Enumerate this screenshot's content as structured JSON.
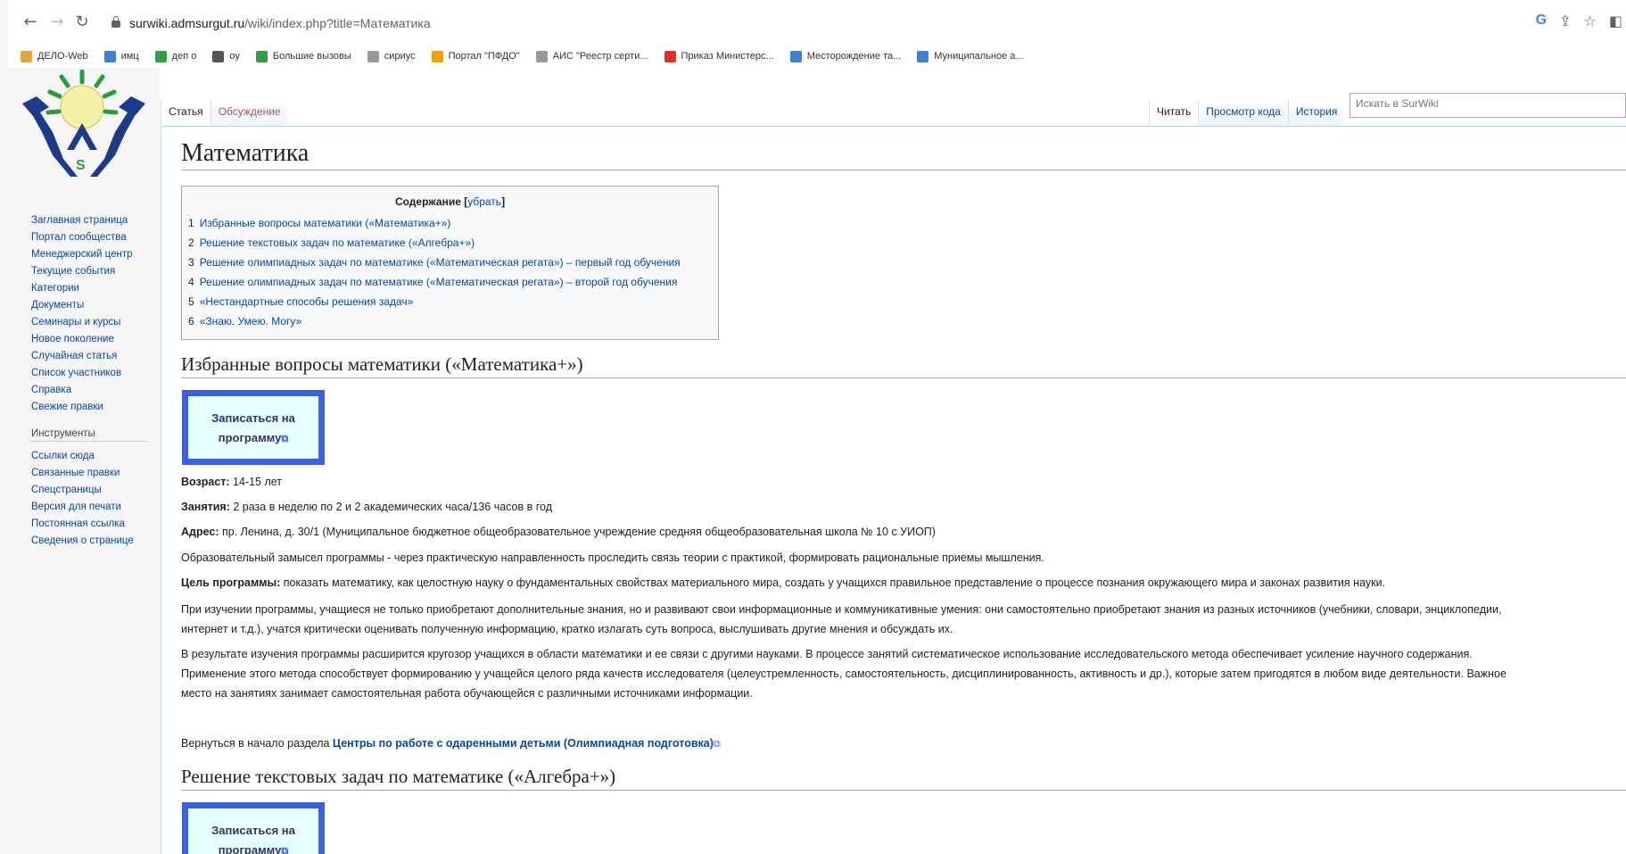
{
  "browser": {
    "url_domain": "surwiki.admsurgut.ru",
    "url_path": "/wiki/index.php?title=Математика",
    "bookmarks": [
      {
        "label": "ДЕЛО-Web",
        "color": "#e8a33d"
      },
      {
        "label": "имц",
        "color": "#3b82d6"
      },
      {
        "label": "деп о",
        "color": "#2f9e44"
      },
      {
        "label": "оу",
        "color": "#555555"
      },
      {
        "label": "Большие вызовы",
        "color": "#2f9e44"
      },
      {
        "label": "сириус",
        "color": "#999999"
      },
      {
        "label": "Портал \"ПФДО\"",
        "color": "#f59f00"
      },
      {
        "label": "АИС \"Реестр серти...",
        "color": "#999999"
      },
      {
        "label": "Приказ Министерс...",
        "color": "#e03131"
      },
      {
        "label": "Месторождение та...",
        "color": "#3b82d6"
      },
      {
        "label": "Муниципальное а...",
        "color": "#3b82d6"
      }
    ]
  },
  "sidebar": {
    "navigation": [
      "Заглавная страница",
      "Портал сообщества",
      "Менеджерский центр",
      "Текущие события",
      "Категории",
      "Документы",
      "Семинары и курсы",
      "Новое поколение",
      "Случайная статья",
      "Список участников",
      "Справка",
      "Свежие правки"
    ],
    "tools_heading": "Инструменты",
    "tools": [
      "Ссылки сюда",
      "Связанные правки",
      "Спецстраницы",
      "Версия для печати",
      "Постоянная ссылка",
      "Сведения о странице"
    ]
  },
  "tabs": {
    "left": [
      {
        "label": "Статья"
      },
      {
        "label": "Обсуждение"
      }
    ],
    "right": [
      {
        "label": "Читать"
      },
      {
        "label": "Просмотр кода"
      },
      {
        "label": "История"
      }
    ]
  },
  "search": {
    "placeholder": "Искать в SurWiki"
  },
  "page": {
    "title": "Математика",
    "toc": {
      "title": "Содержание",
      "toggle": "убрать",
      "items": [
        {
          "num": "1",
          "text": "Избранные вопросы математики («Математика+»)"
        },
        {
          "num": "2",
          "text": "Решение текстовых задач по математике («Алгебра+»)"
        },
        {
          "num": "3",
          "text": "Решение олимпиадных задач по математике («Математическая регата») – первый год обучения"
        },
        {
          "num": "4",
          "text": "Решение олимпиадных задач по математике («Математическая регата») – второй год обучения"
        },
        {
          "num": "5",
          "text": "«Нестандартные способы решения задач»"
        },
        {
          "num": "6",
          "text": "«Знаю. Умею. Могу»"
        }
      ]
    },
    "section1": {
      "heading": "Избранные вопросы математики («Математика+»)",
      "enroll_line1": "Записаться на",
      "enroll_line2": "программу",
      "age_label": "Возраст:",
      "age": " 14-15 лет",
      "lessons_label": "Занятия:",
      "lessons": " 2 раза в неделю по 2 и 2 академических часа/136 часов в год",
      "address_label": "Адрес:",
      "address": " пр. Ленина, д. 30/1 (Муниципальное бюджетное общеобразовательное учреждение средняя общеобразовательная школа № 10 с УИОП)",
      "concept": "Образовательный замысел программы - через практическую направленность проследить связь теории с практикой, формировать рациональные приемы мышления.",
      "goal_label": "Цель программы:",
      "goal": " показать математику, как целостную науку о фундаментальных свойствах материального мира, создать у учащихся правильное представление о процессе познания окружающего мира и законах развития науки.",
      "p1_line1": "При изучении программы, учащиеся не только приобретают дополнительные знания, но и развивают свои информационные и коммуникативные умения: они самостоятельно приобретают знания из разных источников (учебники, словари, энциклопедии,",
      "p1_line2": "интернет и т.д.), учатся критически оценивать полученную информацию, кратко излагать суть вопроса, выслушивать другие мнения и обсуждать их.",
      "p2_line1": "В результате изучения программы расширится кругозор учащихся в области математики и ее связи с другими науками. В процессе занятий систематическое использование исследовательского метода обеспечивает усиление научного содержания.",
      "p2_line2": "Применение этого метода способствует формированию у учащейся целого ряда качеств исследователя (целеустремленность, самостоятельность, дисциплинированность, активность и др.), которые затем пригодятся в любом виде деятельности. Важное",
      "p2_line3": "место на занятиях занимает самостоятельная работа обучающейся с различными источниками информации.",
      "return_text": "Вернуться в начало раздела ",
      "return_link": "Центры по работе с одаренными детьми (Олимпиадная подготовка)"
    },
    "section2": {
      "heading": "Решение текстовых задач по математике («Алгебра+»)",
      "enroll_line1": "Записаться на",
      "enroll_line2": "программу"
    }
  }
}
